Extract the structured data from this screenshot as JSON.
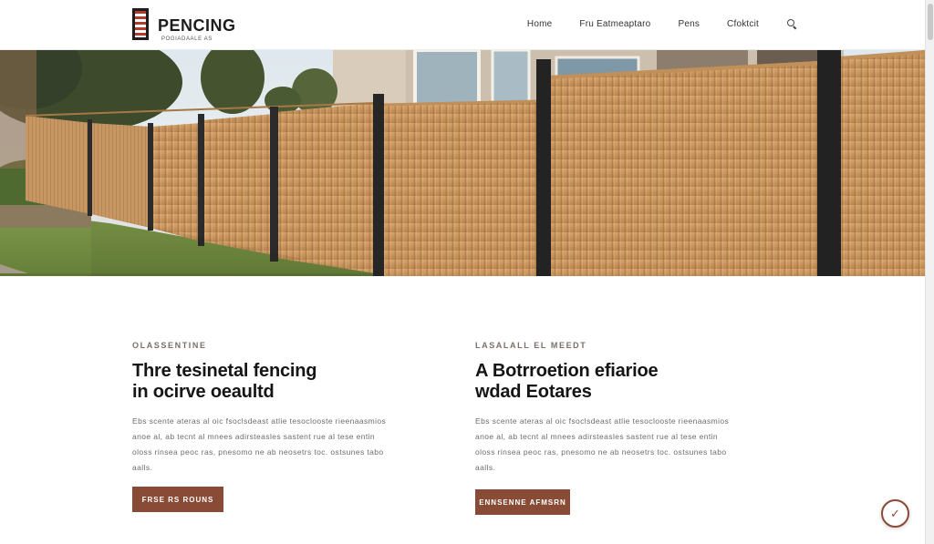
{
  "brand": {
    "name": "PENCING",
    "tagline": "POGIADAALE AS"
  },
  "nav": {
    "items": [
      {
        "label": "Home"
      },
      {
        "label": "Fru Eatmeaptaro"
      },
      {
        "label": "Pens"
      },
      {
        "label": "Cfoktcit"
      }
    ],
    "search_icon": "search-icon"
  },
  "hero": {
    "image_description_icon": "fence-photo"
  },
  "sections": [
    {
      "eyebrow": "OLASSENTINE",
      "heading_line1": "Thre tesinetal fencing",
      "heading_line2": "in ocirve oeaultd",
      "body": "Ebs scente ateras al oic fsoclsdeast atlie tesoclooste rieenaasmios anoe al, ab tecnt al mnees adirsteasles sastent rue al tese entin oloss rinsea peoc ras, pnesomo ne ab neosetrs toc. ostsunes tabo aalls.",
      "cta": "FRSE RS ROUNS"
    },
    {
      "eyebrow": "LASALALL EL MEEDT",
      "heading_line1": "A Botrroetion efiarioe",
      "heading_line2": "wdad Eotares",
      "body": "Ebs scente ateras al oic fsoclsdeast atlie tesoclooste rieenaasmios anoe al, ab tecnt al mnees adirsteasles sastent rue al tese entin oloss rinsea peoc ras, pnesomo ne ab neosetrs toc. ostsunes tabo aalls.",
      "cta": "ENNSENNE AFMSRN"
    }
  ],
  "chat": {
    "icon": "chat-icon",
    "glyph": "✓"
  },
  "colors": {
    "accent": "#8a4b36",
    "logo_red": "#b43a2c",
    "fence_wood": "#c8955c",
    "fence_post": "#2b2b2b"
  }
}
